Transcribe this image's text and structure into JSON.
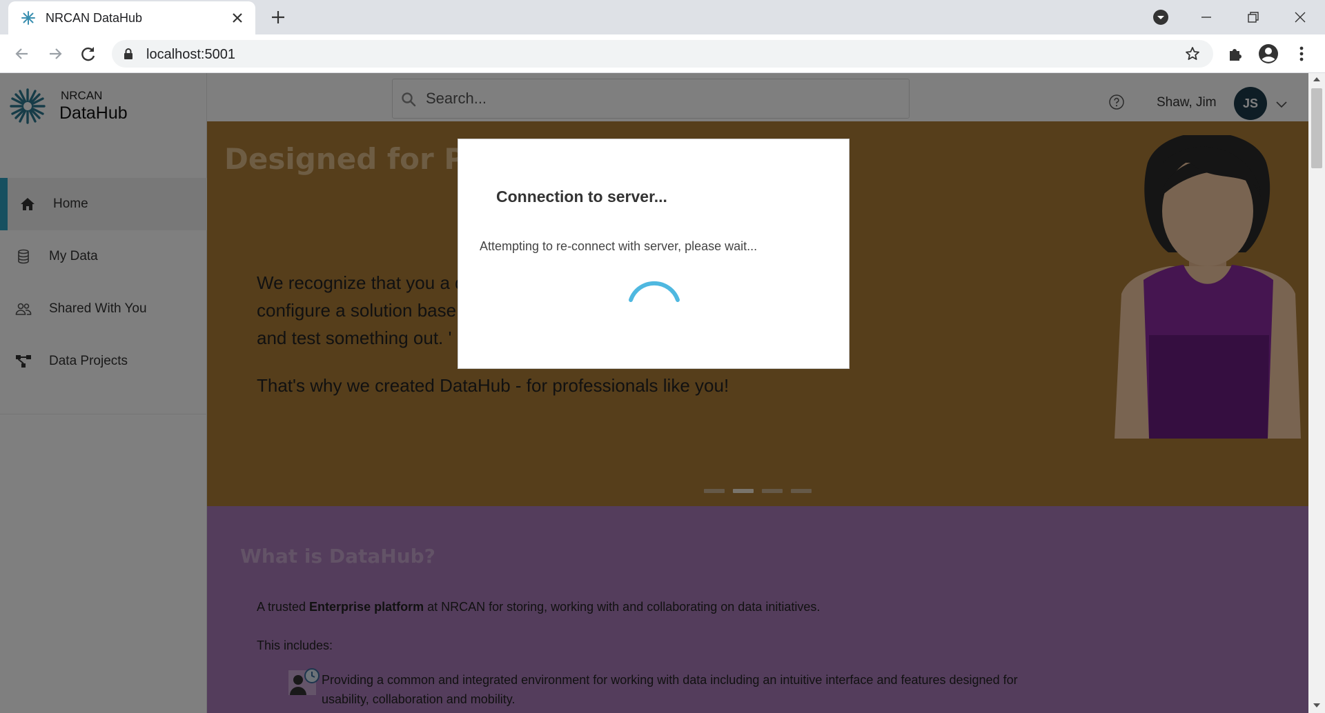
{
  "browser": {
    "tab_title": "NRCAN DataHub",
    "url": "localhost:5001"
  },
  "sidebar": {
    "brand_small": "NRCAN",
    "brand_big": "DataHub",
    "items": [
      {
        "label": "Home",
        "icon": "home-icon",
        "active": true
      },
      {
        "label": "My Data",
        "icon": "database-icon",
        "active": false
      },
      {
        "label": "Shared With You",
        "icon": "users-icon",
        "active": false
      },
      {
        "label": "Data Projects",
        "icon": "project-tree-icon",
        "active": false
      }
    ]
  },
  "header": {
    "search_placeholder": "Search...",
    "user_name": "Shaw, Jim",
    "user_initials": "JS"
  },
  "hero": {
    "title": "Designed for Pro",
    "body": "We recognize that you a                                              desire to create and\nconfigure a solution base                                             o spin up an environment\nand test something out. '",
    "tagline": "That's why we created DataHub - for professionals like you!",
    "slides_total": 4,
    "active_slide": 2
  },
  "about": {
    "title": "What is DataHub?",
    "lead_prefix": "A trusted ",
    "lead_bold": "Enterprise platform",
    "lead_suffix": " at NRCAN for storing, working with and collaborating on data initiatives.",
    "includes": "This includes:",
    "feature_1": "Providing a common and integrated environment for working with data including an intuitive interface and features designed for usability, collaboration and mobility."
  },
  "modal": {
    "title": "Connection to server...",
    "message": "Attempting to re-connect with server, please wait..."
  },
  "colors": {
    "accent": "#2ea0c0",
    "hero_bg": "#ad7c37",
    "about_bg": "#a87ab8",
    "avatar_bg": "#1c3a4a",
    "spinner": "#4fb8e0"
  }
}
